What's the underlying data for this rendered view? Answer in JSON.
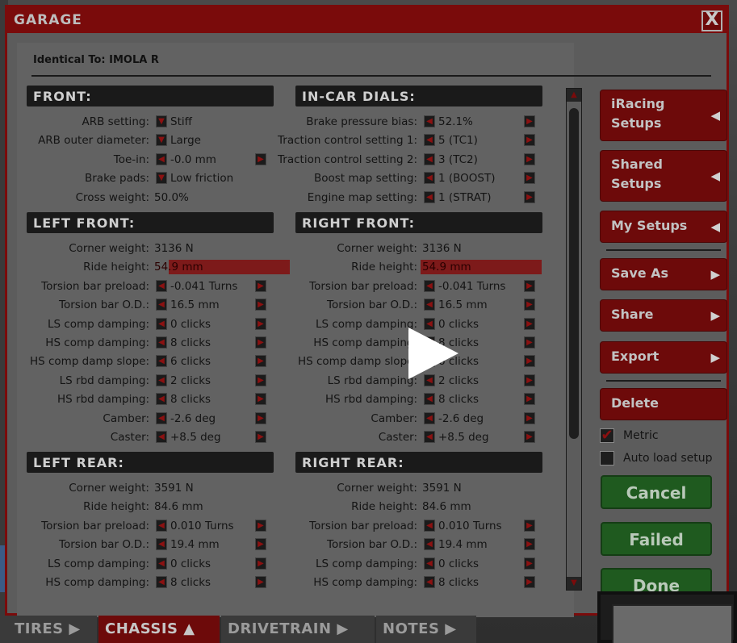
{
  "window": {
    "title": "GARAGE",
    "close_symbol": "X",
    "identical_to": "Identical To: IMOLA R"
  },
  "front": {
    "header": "FRONT:",
    "rows": [
      {
        "label": "ARB setting:",
        "value": "Stiff"
      },
      {
        "label": "ARB outer diameter:",
        "value": "Large"
      },
      {
        "label": "Toe-in:",
        "value": "-0.0 mm"
      },
      {
        "label": "Brake pads:",
        "value": "Low friction"
      },
      {
        "label": "Cross weight:",
        "value": "50.0%"
      }
    ]
  },
  "dials": {
    "header": "IN-CAR DIALS:",
    "rows": [
      {
        "label": "Brake pressure bias:",
        "value": "52.1%"
      },
      {
        "label": "Traction control setting 1:",
        "value": "5 (TC1)"
      },
      {
        "label": "Traction control setting 2:",
        "value": "3 (TC2)"
      },
      {
        "label": "Boost map setting:",
        "value": "1 (BOOST)"
      },
      {
        "label": "Engine map setting:",
        "value": "1 (STRAT)"
      }
    ]
  },
  "left_front": {
    "header": "LEFT FRONT:",
    "rows": [
      {
        "label": "Corner weight:",
        "value": "3136 N"
      },
      {
        "label": "Ride height:",
        "value": "54.9 mm"
      },
      {
        "label": "Torsion bar preload:",
        "value": "-0.041 Turns"
      },
      {
        "label": "Torsion bar O.D.:",
        "value": "16.5 mm"
      },
      {
        "label": "LS comp damping:",
        "value": "0 clicks"
      },
      {
        "label": "HS comp damping:",
        "value": "8 clicks"
      },
      {
        "label": "HS comp damp slope:",
        "value": "6 clicks"
      },
      {
        "label": "LS rbd damping:",
        "value": "2 clicks"
      },
      {
        "label": "HS rbd damping:",
        "value": "8 clicks"
      },
      {
        "label": "Camber:",
        "value": "-2.6 deg"
      },
      {
        "label": "Caster:",
        "value": "+8.5 deg"
      }
    ]
  },
  "right_front": {
    "header": "RIGHT FRONT:",
    "rows": [
      {
        "label": "Corner weight:",
        "value": "3136 N"
      },
      {
        "label": "Ride height:",
        "value": "54.9 mm"
      },
      {
        "label": "Torsion bar preload:",
        "value": "-0.041 Turns"
      },
      {
        "label": "Torsion bar O.D.:",
        "value": "16.5 mm"
      },
      {
        "label": "LS comp damping:",
        "value": "0 clicks"
      },
      {
        "label": "HS comp damping:",
        "value": "8 clicks"
      },
      {
        "label": "HS comp damp slope:",
        "value": "6 clicks"
      },
      {
        "label": "LS rbd damping:",
        "value": "2 clicks"
      },
      {
        "label": "HS rbd damping:",
        "value": "8 clicks"
      },
      {
        "label": "Camber:",
        "value": "-2.6 deg"
      },
      {
        "label": "Caster:",
        "value": "+8.5 deg"
      }
    ]
  },
  "left_rear": {
    "header": "LEFT REAR:",
    "rows": [
      {
        "label": "Corner weight:",
        "value": "3591 N"
      },
      {
        "label": "Ride height:",
        "value": "84.6 mm"
      },
      {
        "label": "Torsion bar preload:",
        "value": "0.010 Turns"
      },
      {
        "label": "Torsion bar O.D.:",
        "value": "19.4 mm"
      },
      {
        "label": "LS comp damping:",
        "value": "0 clicks"
      },
      {
        "label": "HS comp damping:",
        "value": "8 clicks"
      }
    ]
  },
  "right_rear": {
    "header": "RIGHT REAR:",
    "rows": [
      {
        "label": "Corner weight:",
        "value": "3591 N"
      },
      {
        "label": "Ride height:",
        "value": "84.6 mm"
      },
      {
        "label": "Torsion bar preload:",
        "value": "0.010 Turns"
      },
      {
        "label": "Torsion bar O.D.:",
        "value": "19.4 mm"
      },
      {
        "label": "LS comp damping:",
        "value": "0 clicks"
      },
      {
        "label": "HS comp damping:",
        "value": "8 clicks"
      }
    ]
  },
  "sidebar": {
    "iracing_setups": "iRacing\nSetups",
    "shared_setups": "Shared\nSetups",
    "my_setups": "My Setups",
    "save_as": "Save As",
    "share": "Share",
    "export": "Export",
    "delete": "Delete",
    "metric_label": "Metric",
    "metric_checked": true,
    "auto_load_label": "Auto load setup",
    "auto_load_checked": false,
    "cancel": "Cancel",
    "failed": "Failed",
    "done": "Done"
  },
  "tabs": {
    "tires": "TIRES",
    "chassis": "CHASSIS",
    "drivetrain": "DRIVETRAIN",
    "notes": "NOTES"
  },
  "colors": {
    "accent": "#7a0b0b",
    "highlight": "#7d1a1a",
    "green": "#1f5a1f"
  }
}
